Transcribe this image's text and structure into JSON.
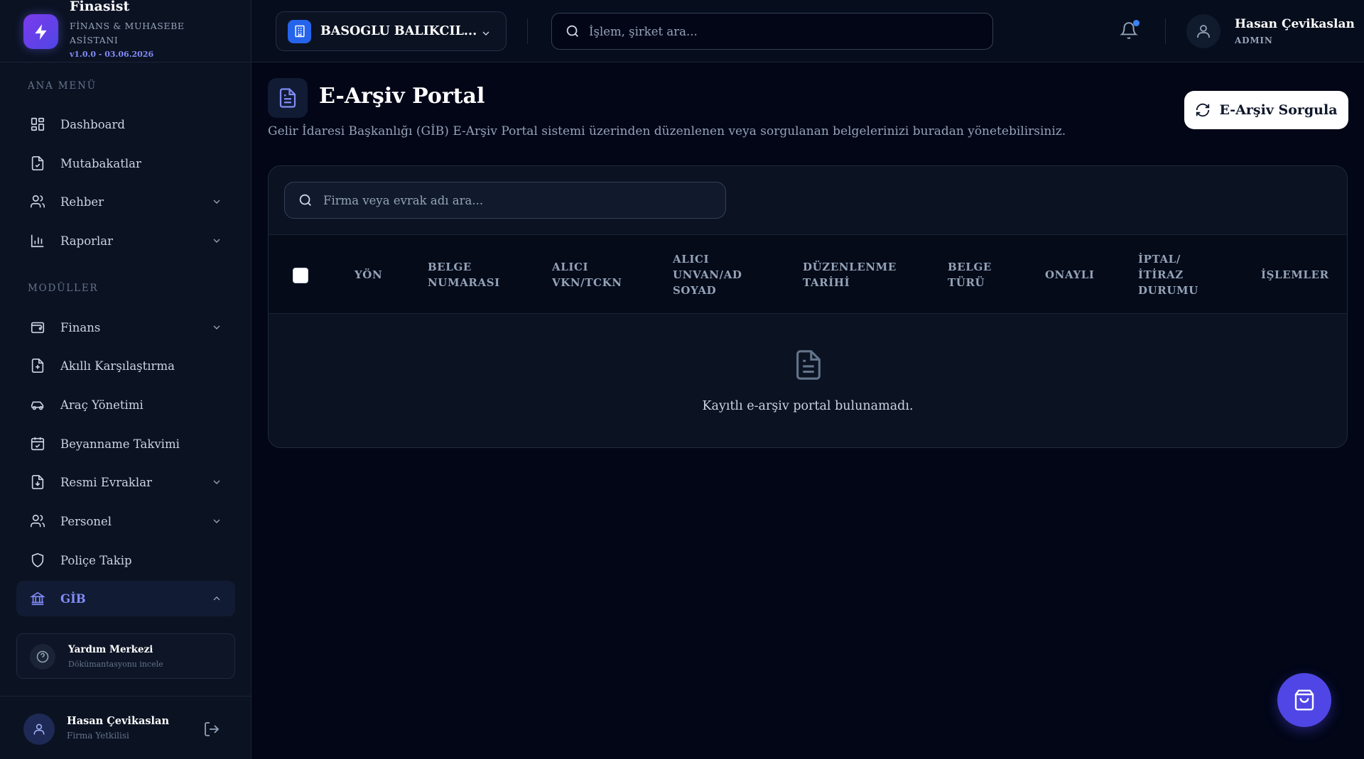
{
  "brand": {
    "name": "Finasist",
    "subtitle": "FİNANS & MUHASEBE ASİSTANI",
    "version": "v1.0.0 - 03.06.2026"
  },
  "sidebar": {
    "section_main": "ANA MENÜ",
    "section_modules": "MODÜLLER",
    "items": [
      {
        "label": "Dashboard",
        "icon": "dashboard-icon"
      },
      {
        "label": "Mutabakatlar",
        "icon": "document-check-icon"
      },
      {
        "label": "Rehber",
        "icon": "users-icon"
      },
      {
        "label": "Raporlar",
        "icon": "bar-chart-icon"
      },
      {
        "label": "Finans",
        "icon": "wallet-icon"
      },
      {
        "label": "Akıllı Karşılaştırma",
        "icon": "compare-document-icon"
      },
      {
        "label": "Araç Yönetimi",
        "icon": "car-icon"
      },
      {
        "label": "Beyanname Takvimi",
        "icon": "calendar-icon"
      },
      {
        "label": "Resmi Evraklar",
        "icon": "download-document-icon"
      },
      {
        "label": "Personel",
        "icon": "users-icon"
      },
      {
        "label": "Poliçe Takip",
        "icon": "shield-icon"
      },
      {
        "label": "GİB",
        "icon": "bank-icon"
      }
    ],
    "help": {
      "title": "Yardım Merkezi",
      "subtitle": "Dökümantasyonu incele"
    },
    "user": {
      "name": "Hasan Çevikaslan",
      "role": "Firma Yetkilisi"
    }
  },
  "header": {
    "company": "BASOGLU BALIKCIL...",
    "search_placeholder": "İşlem, şirket ara...",
    "user_name": "Hasan Çevikaslan",
    "user_role": "ADMIN"
  },
  "page": {
    "title": "E-Arşiv Portal",
    "description": "Gelir İdaresi Başkanlığı (GİB) E-Arşiv Portal sistemi üzerinden düzenlenen veya sorgulanan belgelerinizi buradan yönetebilirsiniz.",
    "query_button": "E-Arşiv Sorgula",
    "table_search_placeholder": "Firma veya evrak adı ara...",
    "columns": [
      "YÖN",
      "BELGE NUMARASI",
      "ALICI VKN/TCKN",
      "ALICI UNVAN/AD SOYAD",
      "DÜZENLENME TARİHİ",
      "BELGE TÜRÜ",
      "ONAYLI",
      "İPTAL/ İTİRAZ DURUMU",
      "İŞLEMLER"
    ],
    "empty_text": "Kayıtlı e-arşiv portal bulunamadı."
  },
  "colors": {
    "accent": "#4f46e5",
    "active_text": "#818cf8",
    "background": "#020617"
  }
}
